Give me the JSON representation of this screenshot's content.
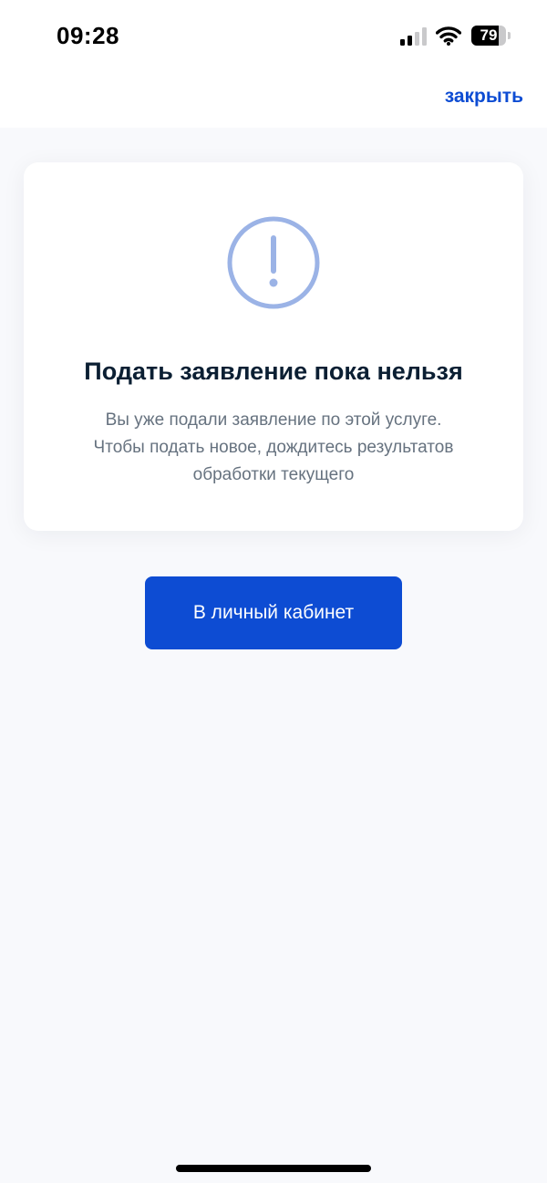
{
  "status_bar": {
    "time": "09:28",
    "battery_level": "79",
    "battery_fraction": 0.79,
    "icons": [
      "signal-icon",
      "wifi-icon",
      "battery-icon"
    ]
  },
  "nav": {
    "close_label": "закрыть"
  },
  "card": {
    "icon": "exclamation-circle-icon",
    "title": "Подать заявление пока нельзя",
    "text_line1": "Вы уже подали заявление по этой услуге.",
    "text_line2": "Чтобы подать новое, дождитесь результатов",
    "text_line3": "обработки текущего"
  },
  "actions": {
    "primary_label": "В личный кабинет"
  },
  "colors": {
    "accent": "#0d4cd3",
    "icon": "#9bb3e6",
    "title": "#0b1f33",
    "text": "#66727f",
    "background": "#f8f9fc"
  }
}
